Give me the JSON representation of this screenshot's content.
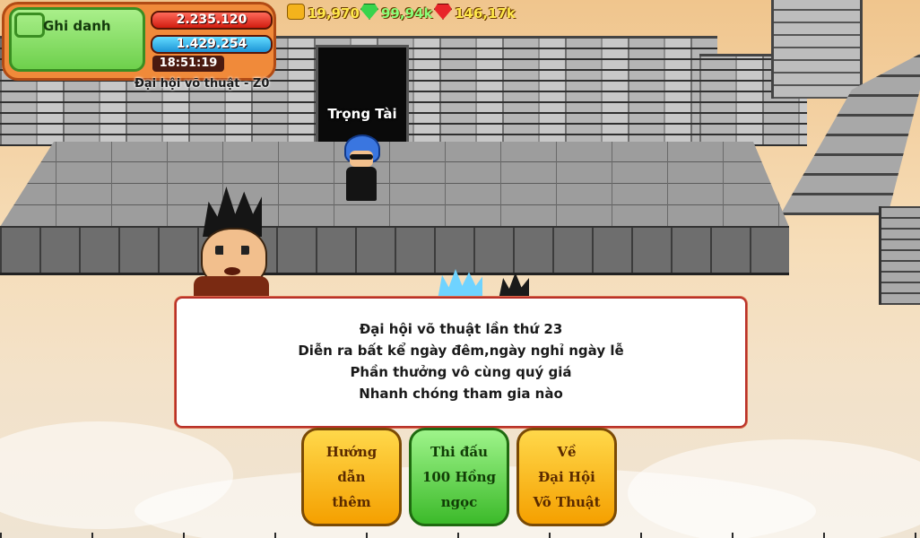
{
  "hud": {
    "name_button": "Ghi danh",
    "hp": "2.235.120",
    "mp": "1.429.254",
    "time": "18:51:19",
    "map_name": "Đại hội võ thuật - Z0"
  },
  "currency": {
    "gold": "19,970",
    "gems": "99,94k",
    "ruby": "146,17k"
  },
  "scene": {
    "door_label": "Trọng Tài"
  },
  "dialog": {
    "lines": [
      "Đại hội võ thuật lần thứ 23",
      "Diễn ra bất kể ngày đêm,ngày nghỉ ngày lễ",
      "Phần thưởng vô cùng quý giá",
      "Nhanh chóng tham gia nào"
    ]
  },
  "buttons": {
    "guide": "Hướng\ndẫn\nthêm",
    "fight": "Thi đấu\n100 Hồng\nngọc",
    "return": "Về\nĐại Hội\nVõ Thuật"
  },
  "colors": {
    "hp": "#d11c10",
    "mp": "#1d94d6",
    "button_yellow": "#f5a000",
    "button_green": "#3cba2a",
    "dialog_border": "#b8322a"
  }
}
